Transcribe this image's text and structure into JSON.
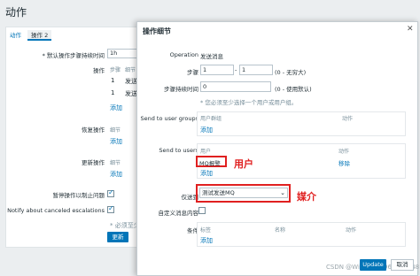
{
  "page": {
    "title": "动作"
  },
  "tabs": [
    "动作",
    "操作 2"
  ],
  "background": {
    "default_duration_label": "* 默认操作步骤持续时间",
    "default_duration_value": "1h",
    "operations_label": "操作",
    "operations_header": [
      "步骤",
      "细节"
    ],
    "operations_rows": [
      {
        "step": "1",
        "detail": "发送"
      },
      {
        "step": "1",
        "detail": "发送"
      }
    ],
    "add": "添加",
    "recovery_label": "恢复操作",
    "recovery_header": "细节",
    "update_ops_label": "更新操作",
    "update_ops_header": "细节",
    "pause_label": "暂停操作以制止问题",
    "notify_canceled_label": "Notify about canceled escalations",
    "warning": "* 必须至少",
    "update_button": "更新"
  },
  "dialog": {
    "title": "操作细节",
    "close_icon": "✕",
    "operation_label": "Operation",
    "operation_value": "发送消息",
    "steps_label": "步骤",
    "steps_from": "1",
    "steps_to": "1",
    "steps_hint": "(0 - 无穷大)",
    "duration_label": "步骤持续时间",
    "duration_value": "0",
    "duration_hint": "(0 - 使用默认)",
    "required_note": "* 您必须至少选择一个用户或用户组。",
    "groups_label": "Send to user groups",
    "groups_headers": [
      "用户群组",
      "动作"
    ],
    "groups_add": "添加",
    "users_label": "Send to users",
    "users_headers": [
      "用户",
      "动作"
    ],
    "users_rows": [
      {
        "user": "MQ报警",
        "action": "移除"
      }
    ],
    "users_add": "添加",
    "send_only_label": "仅送到",
    "send_only_value": "测试发送MQ",
    "custom_message_label": "自定义消息内容",
    "conditions_label": "条件",
    "conditions_headers": [
      "标签",
      "名称",
      "动作"
    ],
    "conditions_add": "添加",
    "update_button": "Update",
    "cancel_button": "取消"
  },
  "annotations": {
    "user": "用户",
    "media": "媒介"
  },
  "watermark": "CSDN @Wisdom_1969022148"
}
